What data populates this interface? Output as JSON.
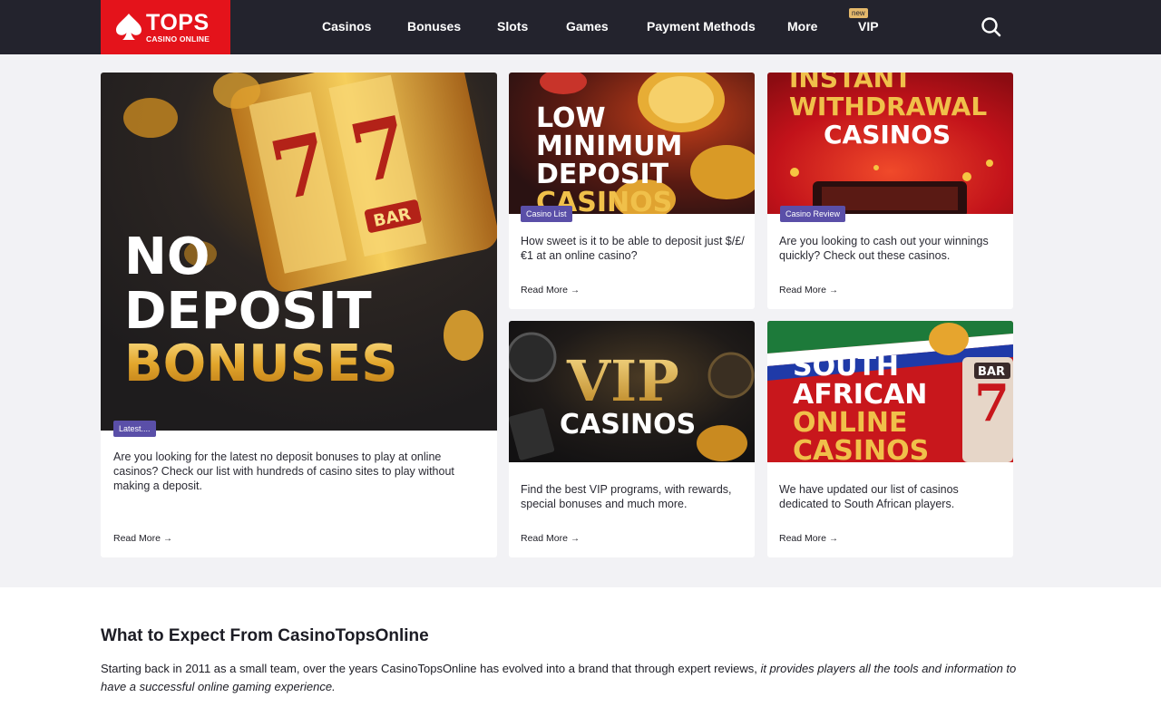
{
  "header": {
    "logo_main": "TOPS",
    "logo_sub": "CASINO ONLINE",
    "nav": [
      "Casinos",
      "Bonuses",
      "Slots",
      "Games",
      "Payment Methods",
      "More",
      "VIP"
    ],
    "new_badge": "new"
  },
  "cards": [
    {
      "image_lines": [
        "NO",
        "DEPOSIT",
        "BONUSES"
      ],
      "badge": "Latest....",
      "description": "Are you looking for the latest no deposit bonuses to play at online casinos? Check our list with hundreds of casino sites to play without making a deposit.",
      "read_more": "Read More"
    },
    {
      "image_lines": [
        "LOW",
        "MINIMUM",
        "DEPOSIT",
        "CASINOS"
      ],
      "badge": "Casino List",
      "description": "How sweet is it to be able to deposit just $/£/€1 at an online casino?",
      "read_more": "Read More"
    },
    {
      "image_lines": [
        "INSTANT",
        "WITHDRAWAL",
        "CASINOS"
      ],
      "badge": "Casino Review",
      "description": "Are you looking to cash out your winnings quickly? Check out these casinos.",
      "read_more": "Read More"
    },
    {
      "image_lines": [
        "VIP",
        "CASINOS"
      ],
      "description": "Find the best VIP programs, with rewards, special bonuses and much more.",
      "read_more": "Read More"
    },
    {
      "image_lines": [
        "SOUTH",
        "AFRICAN",
        "ONLINE",
        "CASINOS"
      ],
      "description": "We have updated our list of casinos dedicated to South African players.",
      "read_more": "Read More"
    }
  ],
  "section": {
    "title": "What to Expect From CasinoTopsOnline",
    "text_plain": "Starting back in 2011 as a small team, over the years CasinoTopsOnline has evolved into a brand that through expert reviews, ",
    "text_italic": "it provides players all the tools and information to have a successful online gaming experience."
  },
  "colors": {
    "header_bg": "#23232d",
    "logo_bg": "#e4131b",
    "badge_bg": "#5a4fa8",
    "gold": "#e8b43a"
  }
}
